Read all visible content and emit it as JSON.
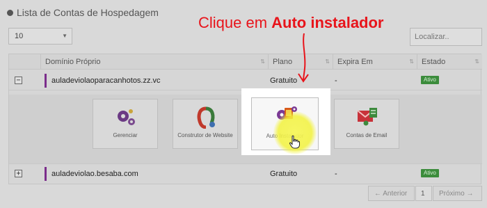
{
  "header": {
    "title": "Lista de Contas de Hospedagem"
  },
  "length_select": {
    "value": "10"
  },
  "search": {
    "placeholder": "Localizar.."
  },
  "table": {
    "columns": [
      "Domínio Próprio",
      "Plano",
      "Expira Em",
      "Estado"
    ],
    "rows": [
      {
        "domain": "auladeviolaoparacanhotos.zz.vc",
        "plan": "Gratuito",
        "expires": "-",
        "status": "Ativo",
        "expander": "−"
      },
      {
        "domain": "auladeviolao.besaba.com",
        "plan": "Gratuito",
        "expires": "-",
        "status": "Ativo",
        "expander": "+"
      }
    ]
  },
  "actions": [
    {
      "label": "Gerenciar",
      "icon": "gears-icon"
    },
    {
      "label": "Construtor de Website",
      "icon": "website-builder-icon"
    },
    {
      "label": "Auto Instalador",
      "icon": "auto-installer-icon"
    },
    {
      "label": "Contas de Email",
      "icon": "email-accounts-icon"
    }
  ],
  "pagination": {
    "prev": "← Anterior",
    "page": "1",
    "next": "Próximo →"
  },
  "callout": {
    "prefix": "Clique em ",
    "emphasis": "Auto instalador"
  },
  "colors": {
    "accent": "#7b2d8b",
    "status": "#3c8c3c",
    "callout": "#e8141b",
    "highlight": "#f2f23c"
  }
}
